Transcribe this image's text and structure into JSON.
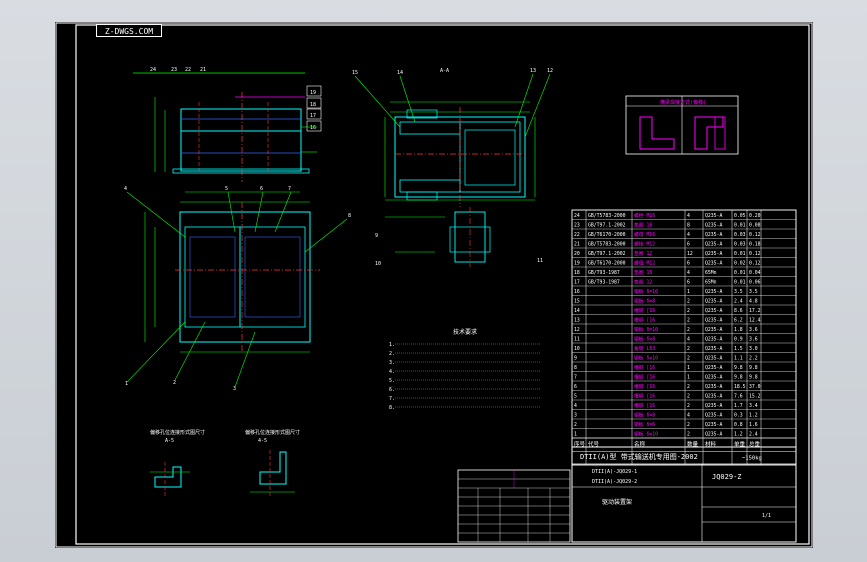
{
  "drawing": {
    "stamp": "Z-DWGS.COM",
    "section_label": "A-A",
    "corner_label": "JQ029-Z",
    "title_main": "DTII(A)型 带式输送机专用图-2002",
    "name": "驱动装置架",
    "sheet_no": "1/1",
    "weight": "~150kg",
    "notes_title": "技术要求",
    "detail_title": "横梁焊接方式(偏移)",
    "view_b_title": "偏移孔位连接形式图尺寸",
    "view_c_title": "偏移孔位连接形式图尺寸",
    "view_b_label": "A-5",
    "view_c_label": "4-5"
  },
  "balloons": [
    "15",
    "14",
    "13",
    "12",
    "24",
    "23",
    "22",
    "21",
    "19",
    "18",
    "17",
    "16",
    "4",
    "5",
    "6",
    "7",
    "8",
    "9",
    "10",
    "11",
    "1",
    "2",
    "3"
  ],
  "part_rows": [
    [
      "24",
      "GB/T5783-2000",
      "螺栓 M16",
      "4",
      "Q235-A",
      "0.05",
      "0.20"
    ],
    [
      "23",
      "GB/T97.1-2002",
      "垫圈 16",
      "8",
      "Q235-A",
      "0.01",
      "0.08"
    ],
    [
      "22",
      "GB/T6170-2000",
      "螺母 M16",
      "4",
      "Q235-A",
      "0.03",
      "0.12"
    ],
    [
      "21",
      "GB/T5783-2000",
      "螺栓 M12",
      "6",
      "Q235-A",
      "0.03",
      "0.18"
    ],
    [
      "20",
      "GB/T97.1-2002",
      "垫圈 12",
      "12",
      "Q235-A",
      "0.01",
      "0.12"
    ],
    [
      "19",
      "GB/T6170-2000",
      "螺母 M12",
      "6",
      "Q235-A",
      "0.02",
      "0.12"
    ],
    [
      "18",
      "GB/T93-1987",
      "垫圈 16",
      "4",
      "65Mn",
      "0.01",
      "0.04"
    ],
    [
      "17",
      "GB/T93-1987",
      "垫圈 12",
      "6",
      "65Mn",
      "0.01",
      "0.06"
    ],
    [
      "16",
      "",
      "钢板 δ=10",
      "1",
      "Q235-A",
      "3.5",
      "3.5"
    ],
    [
      "15",
      "",
      "钢板 δ=8",
      "2",
      "Q235-A",
      "2.4",
      "4.8"
    ],
    [
      "14",
      "",
      "槽钢 [16",
      "2",
      "Q235-A",
      "8.6",
      "17.2"
    ],
    [
      "13",
      "",
      "槽钢 [16",
      "2",
      "Q235-A",
      "6.2",
      "12.4"
    ],
    [
      "12",
      "",
      "钢板 δ=10",
      "2",
      "Q235-A",
      "1.8",
      "3.6"
    ],
    [
      "11",
      "",
      "钢板 δ=8",
      "4",
      "Q235-A",
      "0.9",
      "3.6"
    ],
    [
      "10",
      "",
      "角钢 L63",
      "2",
      "Q235-A",
      "1.5",
      "3.0"
    ],
    [
      "9",
      "",
      "钢板 δ=10",
      "2",
      "Q235-A",
      "1.1",
      "2.2"
    ],
    [
      "8",
      "",
      "槽钢 [16",
      "1",
      "Q235-A",
      "9.8",
      "9.8"
    ],
    [
      "7",
      "",
      "槽钢 [16",
      "1",
      "Q235-A",
      "9.8",
      "9.8"
    ],
    [
      "6",
      "",
      "槽钢 [16",
      "2",
      "Q235-A",
      "18.5",
      "37.0"
    ],
    [
      "5",
      "",
      "槽钢 [16",
      "2",
      "Q235-A",
      "7.6",
      "15.2"
    ],
    [
      "4",
      "",
      "槽钢 [16",
      "2",
      "Q235-A",
      "1.7",
      "3.4"
    ],
    [
      "3",
      "",
      "钢板 δ=8",
      "4",
      "Q235-A",
      "0.3",
      "1.2"
    ],
    [
      "2",
      "",
      "钢板 δ=6",
      "2",
      "Q235-A",
      "0.8",
      "1.6"
    ],
    [
      "1",
      "",
      "钢板 δ=10",
      "2",
      "Q235-A",
      "1.2",
      "2.4"
    ]
  ],
  "part_header": [
    "序号",
    "代号",
    "名称",
    "数量",
    "材料",
    "单重",
    "总重"
  ],
  "codes": [
    "DTII(A)-JQ029-1",
    "DTII(A)-JQ029-2"
  ],
  "colors": {
    "sheet": "#000000",
    "frame": "#ffffff",
    "part": "#00ffff",
    "dim": "#00ff00",
    "center": "#ff3333",
    "text": "#ff00ff",
    "hidden": "#3366ff",
    "table": "#ffffff"
  }
}
